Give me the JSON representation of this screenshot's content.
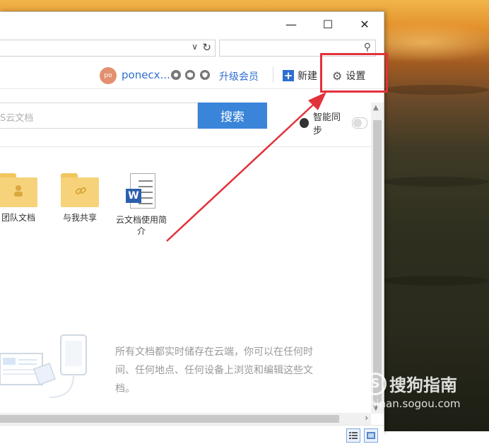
{
  "window": {
    "minimize_glyph": "—",
    "maximize_glyph": "☐",
    "close_glyph": "✕"
  },
  "address_bar": {
    "dropdown_glyph": "∨",
    "refresh_glyph": "↻"
  },
  "window_search": {
    "search_glyph": "⚲"
  },
  "account": {
    "avatar_text": "po",
    "username": "ponecx...",
    "upgrade_label": "升级会员"
  },
  "toolbar": {
    "new_label": "新建",
    "new_glyph": "+",
    "settings_label": "设置",
    "settings_glyph": "⚙"
  },
  "doc_search": {
    "placeholder": "S云文档",
    "button_label": "搜索"
  },
  "sync": {
    "label": "智能同步"
  },
  "items": [
    {
      "label": "团队文档"
    },
    {
      "label": "与我共享"
    },
    {
      "label": "云文档使用简介"
    }
  ],
  "info_text": "所有文档都实时储存在云端，你可以在任何时间、任何地点、任何设备上浏览和编辑这些文档。",
  "watermark": {
    "title": "搜狗指南",
    "url": "zhinan.sogou.com",
    "logo_letter": "S"
  },
  "colors": {
    "accent_blue": "#3a84d9",
    "highlight_red": "#e3313b"
  }
}
